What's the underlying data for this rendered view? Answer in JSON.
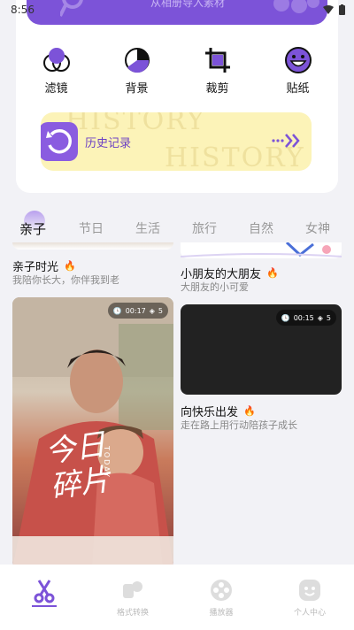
{
  "status": {
    "time": "8:56"
  },
  "banner": {
    "subtitle": "从相册导入素材"
  },
  "tools": [
    {
      "label": "滤镜",
      "icon": "filter-icon"
    },
    {
      "label": "背景",
      "icon": "background-icon"
    },
    {
      "label": "裁剪",
      "icon": "crop-icon"
    },
    {
      "label": "贴纸",
      "icon": "sticker-icon"
    }
  ],
  "history": {
    "label": "历史记录",
    "watermark1": "HISTORY",
    "watermark2": "HISTORY"
  },
  "tabs": [
    "亲子",
    "节日",
    "生活",
    "旅行",
    "自然",
    "女神"
  ],
  "active_tab": "亲子",
  "cards": {
    "c1": {
      "title": "亲子时光",
      "desc": "我陪你长大，你伴我到老"
    },
    "c2": {
      "title": "小朋友的大朋友",
      "desc": "大朋友的小可爱"
    },
    "c3": {
      "duration": "00:17",
      "layers": "5",
      "overlay_big": "今日碎片",
      "overlay_small": "TODAY"
    },
    "c4": {
      "duration": "00:15",
      "layers": "5",
      "title": "向快乐出发",
      "desc": "走在路上用行动陪孩子成长"
    }
  },
  "nav": [
    {
      "label": "",
      "icon": "scissors-icon",
      "active": true
    },
    {
      "label": "格式转换",
      "icon": "format-convert-icon"
    },
    {
      "label": "播放器",
      "icon": "player-reel-icon"
    },
    {
      "label": "个人中心",
      "icon": "profile-icon"
    }
  ],
  "colors": {
    "accent": "#7c53d8",
    "history_bg": "#fcf3b8",
    "flame": "#ff7a2a"
  }
}
